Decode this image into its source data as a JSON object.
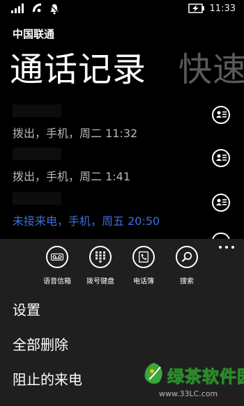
{
  "status_bar": {
    "time": "11:33",
    "icons": [
      "signal-icon",
      "wifi-icon",
      "vibrate-icon",
      "battery-icon"
    ]
  },
  "header": {
    "carrier": "中国联通",
    "pivot_active": "通话记录",
    "pivot_next": "快速"
  },
  "calls": [
    {
      "info": "拨出，手机，周二 11:32",
      "missed": false
    },
    {
      "info": "拨出，手机，周二 1:41",
      "missed": false
    },
    {
      "info": "未接来电，手机，周五 20:50",
      "missed": true
    }
  ],
  "colors": {
    "missed": "#3d6ed8",
    "appbar_bg": "#1f1f1f",
    "pivot_inactive": "#5a5a5a"
  },
  "app_bar": {
    "buttons": [
      {
        "label": "语音信箱",
        "icon": "voicemail-icon"
      },
      {
        "label": "拨号键盘",
        "icon": "keypad-icon"
      },
      {
        "label": "电话簿",
        "icon": "phonebook-icon"
      },
      {
        "label": "搜索",
        "icon": "search-icon"
      }
    ],
    "menu": [
      "设置",
      "全部删除",
      "阻止的来电"
    ]
  },
  "watermark": {
    "text": "绿茶软件园",
    "url": "www.33LC.com"
  }
}
